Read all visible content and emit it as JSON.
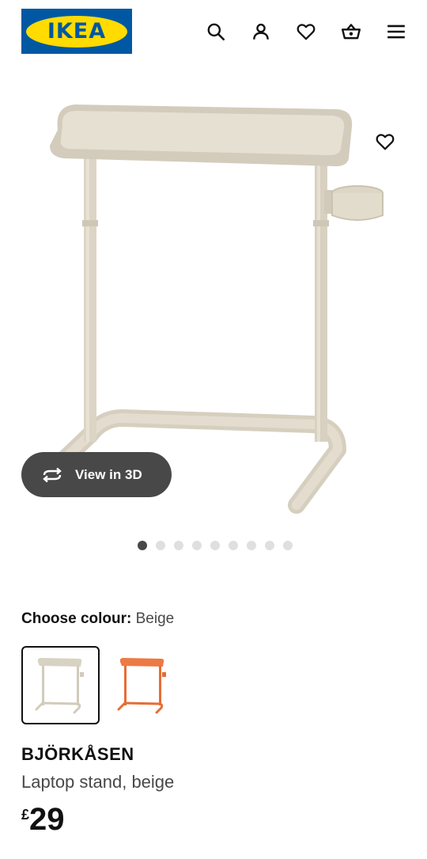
{
  "header": {
    "logo_text": "IKEA",
    "icons": [
      "search-icon",
      "user-icon",
      "heart-icon",
      "basket-icon",
      "menu-icon"
    ]
  },
  "gallery": {
    "view_3d_label": "View in 3D",
    "image_count": 9,
    "active_index": 0
  },
  "colour": {
    "label": "Choose colour:",
    "selected": "Beige",
    "options": [
      {
        "name": "Beige",
        "color": "#d9d3c4"
      },
      {
        "name": "Orange",
        "color": "#e8733e"
      }
    ]
  },
  "product": {
    "name": "BJÖRKÅSEN",
    "description": "Laptop stand, beige",
    "currency": "£",
    "price": "29"
  },
  "colors": {
    "brand_blue": "#0058a3",
    "brand_yellow": "#ffdb00",
    "button_dark": "#484848"
  }
}
